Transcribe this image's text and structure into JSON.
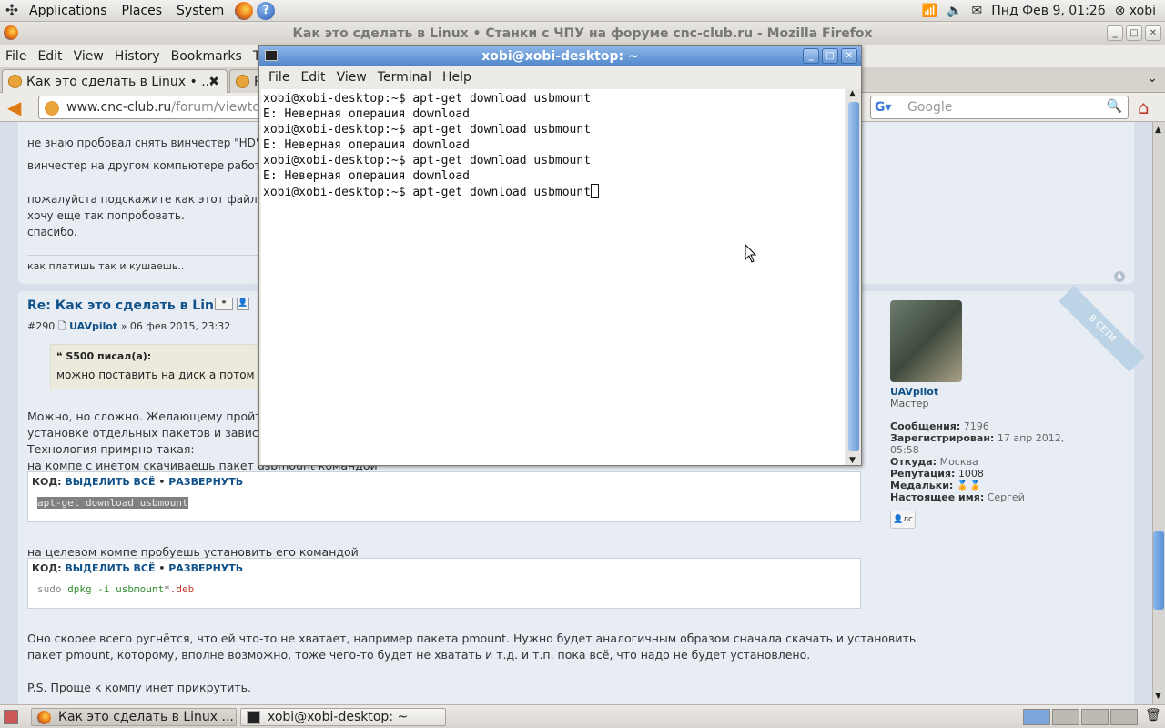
{
  "top_panel": {
    "menus": [
      "Applications",
      "Places",
      "System"
    ],
    "clock": "Пнд Фев  9, 01:26",
    "user": "xobi"
  },
  "firefox": {
    "window_title": "Как это сделать в Linux • Станки с ЧПУ на форуме cnc-club.ru - Mozilla Firefox",
    "menu": [
      "File",
      "Edit",
      "View",
      "History",
      "Bookmarks",
      "T"
    ],
    "tabs": [
      {
        "label": "Как это сделать в Linux • ..."
      },
      {
        "label": "R"
      }
    ],
    "url_display": {
      "domain": "www.cnc-club.ru",
      "path": "/forum/viewtopi"
    },
    "search_placeholder": "Google"
  },
  "page": {
    "post1": {
      "lines": [
        "не знаю пробовал снять винчестер \"HD\" п",
        "винчестер на другом компьютере работа",
        "пожалуйста подскажите как этот файл з",
        "хочу еще так попробовать.",
        "спасибо."
      ],
      "signature": "как платишь так и кушаешь.."
    },
    "post2": {
      "title": "Re: Как это сделать в Linux",
      "meta_id": "#290",
      "author": "UAVpilot",
      "date": "» 06 фев 2015, 23:32",
      "quote_author": "S500 писал(а):",
      "quote_text": "можно поставить на диск а потом уста",
      "body_lines": [
        "Можно, но сложно. Желающему пройти п",
        "установке отдельных пакетов и зависим",
        "Технология примрно такая:",
        "на компе с инетом скачиваешь пакет usbmount командой"
      ],
      "code1": {
        "label": "КОД:",
        "select_all": "ВЫДЕЛИТЬ ВСЁ",
        "sep": "•",
        "expand": "РАЗВЕРНУТЬ",
        "code": "apt-get download usbmount"
      },
      "mid_line": "на целевом компе пробуешь установить его командой",
      "code2": {
        "label": "КОД:",
        "select_all": "ВЫДЕЛИТЬ ВСЁ",
        "sep": "•",
        "expand": "РАЗВЕРНУТЬ",
        "sudo": "sudo",
        "cmd": "dpkg -i usbmount",
        "glob": "*",
        "ext": ".deb"
      },
      "tail_lines": [
        "Оно скорее всего ругнётся, что ей что-то не хватает, например пакета pmount. Нужно будет аналогичным образом сначала скачать и установить",
        "пакет pmount, которому, вполне возможно, тоже чего-то будет не хватать и т.д. и т.п. пока всё, что надо не будет установлено."
      ],
      "ps": "P.S. Проще к компу инет прикрутить."
    },
    "profile": {
      "online_ribbon": "В СЕТИ",
      "name": "UAVpilot",
      "rank": "Мастер",
      "posts_label": "Сообщения:",
      "posts": "7196",
      "reg_label": "Зарегистрирован:",
      "reg": "17 апр 2012, 05:58",
      "from_label": "Откуда:",
      "from": "Москва",
      "rep_label": "Репутация:",
      "rep": "1008",
      "medals_label": "Медальки:",
      "realname_label": "Настоящее имя:",
      "realname": "Сергей",
      "pm": "лс"
    }
  },
  "terminal": {
    "title": "xobi@xobi-desktop: ~",
    "menu": [
      "File",
      "Edit",
      "View",
      "Terminal",
      "Help"
    ],
    "lines": [
      "xobi@xobi-desktop:~$ apt-get download usbmount",
      "E: Неверная операция download",
      "xobi@xobi-desktop:~$ apt-get download usbmount",
      "E: Неверная операция download",
      "xobi@xobi-desktop:~$ apt-get download usbmount",
      "E: Неверная операция download",
      "xobi@xobi-desktop:~$ apt-get download usbmount"
    ]
  },
  "taskbar": {
    "tasks": [
      "Как это сделать в Linux ...",
      "xobi@xobi-desktop: ~"
    ]
  }
}
